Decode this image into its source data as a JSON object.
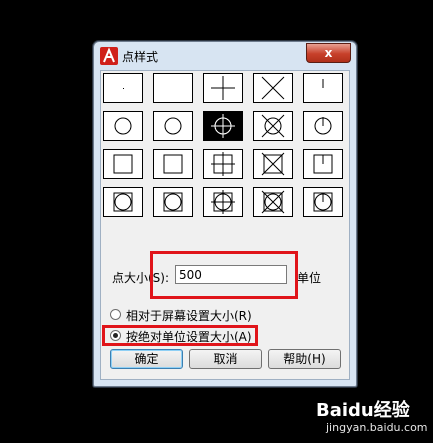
{
  "dialog": {
    "title": "点样式",
    "close_label": "x"
  },
  "point_styles": {
    "selected_index": 7,
    "styles": [
      "dot",
      "none",
      "plus",
      "cross",
      "tick",
      "circle-dot",
      "circle",
      "circle-plus",
      "circle-cross",
      "circle-tick",
      "square-dot",
      "square",
      "square-plus",
      "square-cross",
      "square-tick",
      "squarecircle-dot",
      "squarecircle",
      "squarecircle-plus",
      "squarecircle-cross",
      "squarecircle-tick"
    ]
  },
  "size": {
    "label": "点大小(S):",
    "value": "500",
    "unit_label": "单位"
  },
  "mode": {
    "relative_label": "相对于屏幕设置大小(R)",
    "absolute_label": "按绝对单位设置大小(A)",
    "selected": "absolute"
  },
  "buttons": {
    "ok": "确定",
    "cancel": "取消",
    "help": "帮助(H)"
  },
  "watermark": {
    "brand": "Baidu经验",
    "url": "jingyan.baidu.com"
  },
  "colors": {
    "highlight": "#e0141a",
    "app_icon": "#d0201a"
  }
}
